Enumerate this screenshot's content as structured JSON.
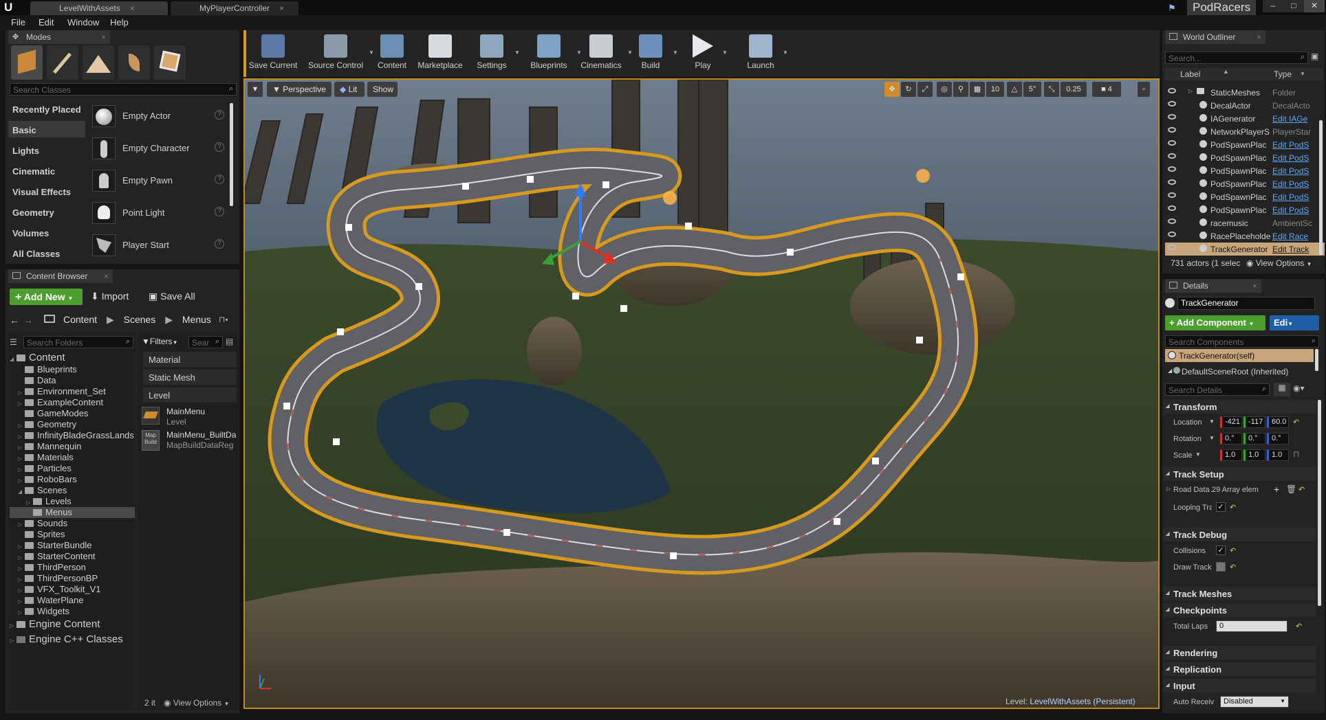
{
  "titlebar": {
    "tabs": [
      {
        "label": "LevelWithAssets"
      },
      {
        "label": "MyPlayerController"
      }
    ],
    "project_name": "PodRacers",
    "close_glyph": "×"
  },
  "menubar": {
    "items": [
      "File",
      "Edit",
      "Window",
      "Help"
    ]
  },
  "modes": {
    "tab_label": "Modes",
    "search_placeholder": "Search Classes",
    "categories": [
      "Recently Placed",
      "Basic",
      "Lights",
      "Cinematic",
      "Visual Effects",
      "Geometry",
      "Volumes",
      "All Classes"
    ],
    "selected_category": "Basic",
    "items": [
      {
        "label": "Empty Actor"
      },
      {
        "label": "Empty Character"
      },
      {
        "label": "Empty Pawn"
      },
      {
        "label": "Point Light"
      },
      {
        "label": "Player Start"
      }
    ]
  },
  "content_browser": {
    "tab_label": "Content Browser",
    "add_new_label": "Add New",
    "import_label": "Import",
    "save_all_label": "Save All",
    "breadcrumb": [
      "Content",
      "Scenes",
      "Menus"
    ],
    "search_folders_placeholder": "Search Folders",
    "filters_label": "Filters",
    "search_assets_placeholder": "Sear",
    "root_label": "Content",
    "folders": [
      "Blueprints",
      "Data",
      "Environment_Set",
      "ExampleContent",
      "GameModes",
      "Geometry",
      "InfinityBladeGrassLands",
      "Mannequin",
      "Materials",
      "Particles",
      "RoboBars",
      "Scenes",
      "Levels",
      "Menus",
      "Sounds",
      "Sprites",
      "StarterBundle",
      "StarterContent",
      "ThirdPerson",
      "ThirdPersonBP",
      "VFX_Toolkit_V1",
      "WaterPlane",
      "Widgets"
    ],
    "engine_content": "Engine Content",
    "engine_cpp": "Engine C++ Classes",
    "filter_items": [
      "Material",
      "Static Mesh",
      "Level"
    ],
    "assets": [
      {
        "name": "MainMenu",
        "type": "Level",
        "thumb": ""
      },
      {
        "name": "MainMenu_BuiltDa",
        "type": "MapBuildDataReg",
        "thumb": "Map Build"
      }
    ],
    "item_count": "2 it",
    "view_options": "View Options"
  },
  "toolbar": {
    "buttons": [
      "Save Current",
      "Source Control",
      "Content",
      "Marketplace",
      "Settings",
      "Blueprints",
      "Cinematics",
      "Build",
      "Play",
      "Launch"
    ]
  },
  "viewport": {
    "perspective": "Perspective",
    "lit": "Lit",
    "show": "Show",
    "grid_snap": "10",
    "rot_snap": "5°",
    "scale_snap": "0.25",
    "camera_speed": "4",
    "level_label": "Level:",
    "level_name": "LevelWithAssets (Persistent)"
  },
  "world_outliner": {
    "tab_label": "World Outliner",
    "search_placeholder": "Search...",
    "col_label": "Label",
    "col_type": "Type",
    "rows": [
      {
        "label": "StaticMeshes",
        "type": "Folder",
        "link": false
      },
      {
        "label": "DecalActor",
        "type": "DecalActo",
        "link": false
      },
      {
        "label": "IAGenerator",
        "type": "Edit IAGe",
        "link": true
      },
      {
        "label": "NetworkPlayerS",
        "type": "PlayerStar",
        "link": false
      },
      {
        "label": "PodSpawnPlac",
        "type": "Edit PodS",
        "link": true
      },
      {
        "label": "PodSpawnPlac",
        "type": "Edit PodS",
        "link": true
      },
      {
        "label": "PodSpawnPlac",
        "type": "Edit PodS",
        "link": true
      },
      {
        "label": "PodSpawnPlac",
        "type": "Edit PodS",
        "link": true
      },
      {
        "label": "PodSpawnPlac",
        "type": "Edit PodS",
        "link": true
      },
      {
        "label": "PodSpawnPlac",
        "type": "Edit PodS",
        "link": true
      },
      {
        "label": "racemusic",
        "type": "AmbientSc",
        "link": false
      },
      {
        "label": "RacePlaceholde",
        "type": "Edit Race",
        "link": true
      },
      {
        "label": "TrackGenerator",
        "type": "Edit Track",
        "link": true
      }
    ],
    "actor_count": "731 actors (1 selec",
    "view_options": "View Options"
  },
  "details": {
    "tab_label": "Details",
    "name_value": "TrackGenerator",
    "add_component": "Add Component",
    "edit_label": "Edi",
    "search_components_placeholder": "Search Components",
    "components": [
      "TrackGenerator(self)",
      "DefaultSceneRoot (Inherited)"
    ],
    "search_details_placeholder": "Search Details",
    "transform": {
      "title": "Transform",
      "location_label": "Location",
      "location": [
        "-421",
        "-117",
        "60.0"
      ],
      "rotation_label": "Rotation",
      "rotation": [
        "0.°",
        "0.°",
        "0.°"
      ],
      "scale_label": "Scale",
      "scale": [
        "1.0",
        "1.0",
        "1.0"
      ]
    },
    "track_setup": {
      "title": "Track Setup",
      "road_data_label": "Road Data A",
      "road_data_value": "29 Array elem",
      "looping_label": "Looping Tra"
    },
    "track_debug": {
      "title": "Track Debug",
      "collisions_label": "Collisions",
      "draw_track_label": "Draw Track"
    },
    "track_meshes": "Track Meshes",
    "checkpoints": {
      "title": "Checkpoints",
      "total_laps_label": "Total Laps",
      "total_laps_value": "0"
    },
    "rendering": "Rendering",
    "replication": "Replication",
    "input": {
      "title": "Input",
      "auto_receive_label": "Auto Receiv",
      "auto_receive_value": "Disabled"
    }
  },
  "colors": {
    "accent_orange": "#c28a1a",
    "add_green": "#4c9e2f",
    "link_blue": "#5aa9ff",
    "edit_blue": "#1f5fa8"
  }
}
